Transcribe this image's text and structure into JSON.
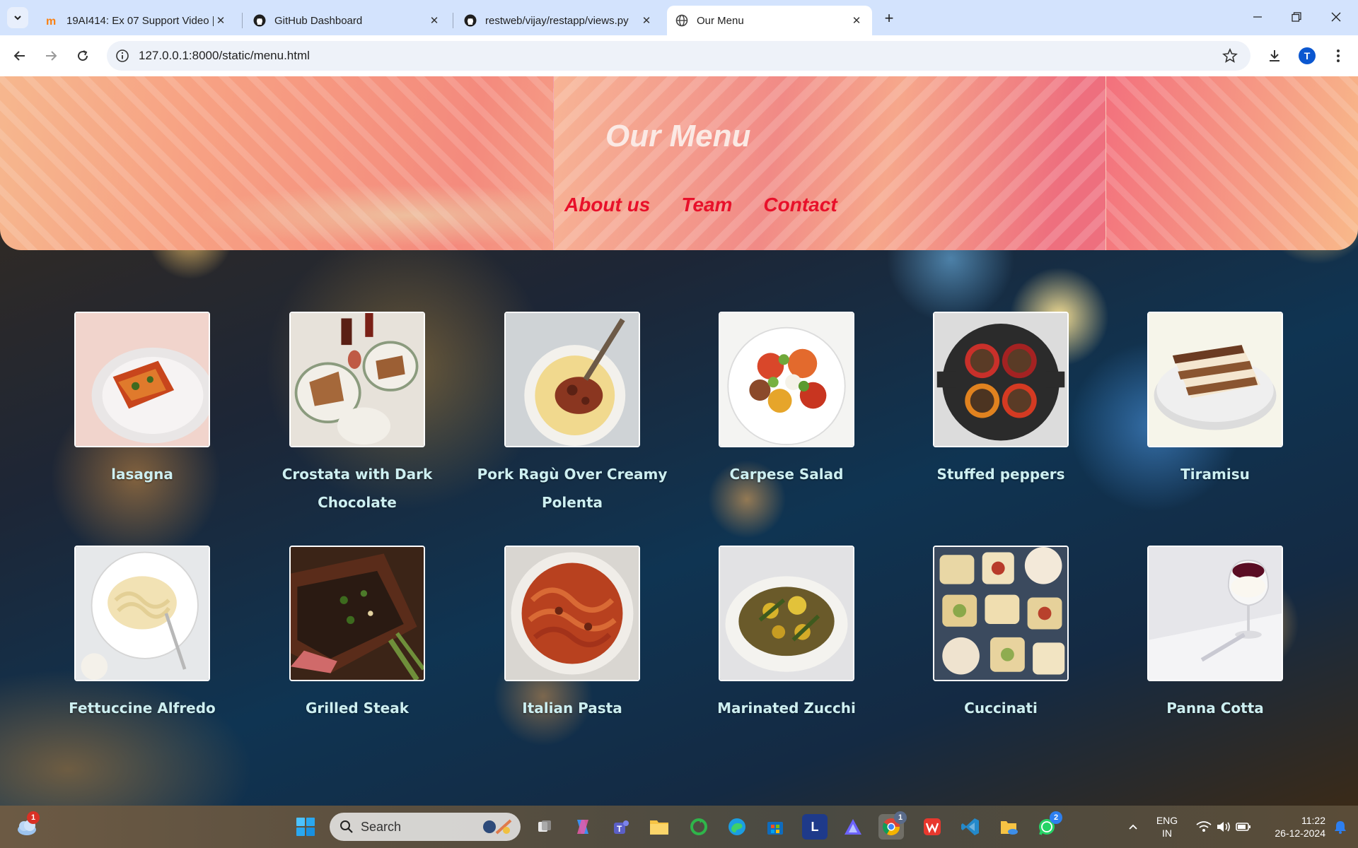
{
  "browser": {
    "tabs": [
      {
        "title": "19AI414: Ex 07 Support Video |",
        "icon": "moodle-icon",
        "active": false
      },
      {
        "title": "GitHub Dashboard",
        "icon": "github-icon",
        "active": false
      },
      {
        "title": "restweb/vijay/restapp/views.py",
        "icon": "github-icon",
        "active": false
      },
      {
        "title": "Our Menu",
        "icon": "globe-icon",
        "active": true
      }
    ],
    "url": "127.0.0.1:8000/static/menu.html",
    "profile_initial": "T"
  },
  "header": {
    "title": "Our Menu",
    "nav": [
      "About us",
      "Team",
      "Contact"
    ]
  },
  "menu_items": [
    {
      "name": "lasagna",
      "image": "lasagna-photo"
    },
    {
      "name": "Crostata with Dark Chocolate",
      "image": "crostata-photo"
    },
    {
      "name": "Pork Ragù Over Creamy Polenta",
      "image": "polenta-photo"
    },
    {
      "name": "Carpese Salad",
      "image": "salad-photo"
    },
    {
      "name": "Stuffed peppers",
      "image": "peppers-photo"
    },
    {
      "name": "Tiramisu",
      "image": "tiramisu-photo"
    },
    {
      "name": "Fettuccine Alfredo",
      "image": "fettuccine-photo"
    },
    {
      "name": "Grilled Steak",
      "image": "steak-photo"
    },
    {
      "name": "Italian Pasta",
      "image": "pasta-photo"
    },
    {
      "name": "Marinated Zucchi",
      "image": "zucchini-photo"
    },
    {
      "name": "Cuccinati",
      "image": "cookies-photo"
    },
    {
      "name": "Panna Cotta",
      "image": "panna-cotta-photo"
    }
  ],
  "taskbar": {
    "search_placeholder": "Search",
    "weather_badge": "1",
    "chrome_badge": "1",
    "whatsapp_badge": "2",
    "language": "ENG",
    "region": "IN",
    "time": "11:22",
    "date": "26-12-2024"
  },
  "colors": {
    "nav_link": "#e8102a",
    "title": "#fbe9e4",
    "food_name": "#cdeff1"
  }
}
